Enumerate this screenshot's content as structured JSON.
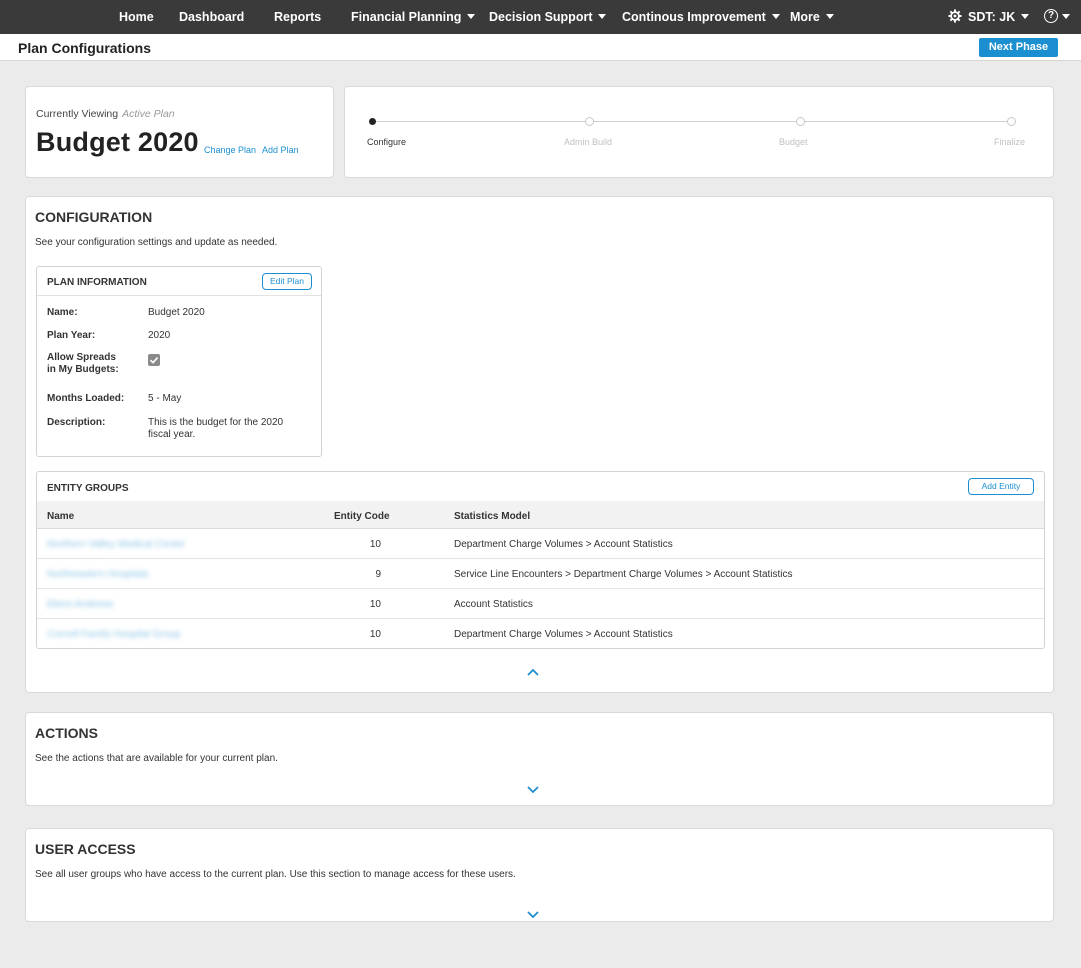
{
  "nav": {
    "items": [
      {
        "label": "Home"
      },
      {
        "label": "Dashboard"
      },
      {
        "label": "Reports"
      },
      {
        "label": "Financial Planning"
      },
      {
        "label": "Decision Support"
      },
      {
        "label": "Continous Improvement"
      },
      {
        "label": "More"
      }
    ],
    "user_label": "SDT: JK",
    "help_glyph": "?"
  },
  "header": {
    "title": "Plan Configurations",
    "next_phase_label": "Next Phase"
  },
  "plan": {
    "currently_viewing_label": "Currently Viewing",
    "currently_viewing_value": "Active Plan",
    "name": "Budget 2020",
    "change_plan_label": "Change Plan",
    "add_plan_label": "Add Plan"
  },
  "stepper": {
    "steps": [
      {
        "label": "Configure",
        "active": true
      },
      {
        "label": "Admin Build",
        "active": false
      },
      {
        "label": "Budget",
        "active": false
      },
      {
        "label": "Finalize",
        "active": false
      }
    ]
  },
  "configuration": {
    "title": "CONFIGURATION",
    "description": "See your configuration settings and update as needed.",
    "plan_info": {
      "title": "PLAN INFORMATION",
      "edit_label": "Edit Plan",
      "name_label": "Name:",
      "name_value": "Budget 2020",
      "year_label": "Plan Year:",
      "year_value": "2020",
      "spreads_label_1": "Allow Spreads",
      "spreads_label_2": "in My Budgets:",
      "spreads_checked": true,
      "months_label": "Months Loaded:",
      "months_value": "5 - May",
      "description_label": "Description:",
      "description_line_1": "This is the budget for the 2020",
      "description_line_2": "fiscal year."
    },
    "entity_groups": {
      "title": "ENTITY GROUPS",
      "add_label": "Add Entity",
      "columns": {
        "name": "Name",
        "code": "Entity Code",
        "model": "Statistics Model"
      },
      "rows": [
        {
          "name": "Northern Valley Medical Center",
          "code": "10",
          "model": "Department Charge Volumes > Account Statistics"
        },
        {
          "name": "Northeastern Hospitals",
          "code": "9",
          "model": "Service Line Encounters > Department Charge Volumes > Account Statistics"
        },
        {
          "name": "Eboni Andrews",
          "code": "10",
          "model": "Account Statistics"
        },
        {
          "name": "Cornell Family Hospital Group",
          "code": "10",
          "model": "Department Charge Volumes > Account Statistics"
        }
      ]
    }
  },
  "actions": {
    "title": "ACTIONS",
    "description": "See the actions that are available for your current plan."
  },
  "user_access": {
    "title": "USER ACCESS",
    "description": "See all user groups who have access to the current plan. Use this section to manage access for these users."
  },
  "colors": {
    "nav_bg": "#3a3a3a",
    "accent": "#1c8fd0",
    "page_bg": "#ebebeb"
  }
}
